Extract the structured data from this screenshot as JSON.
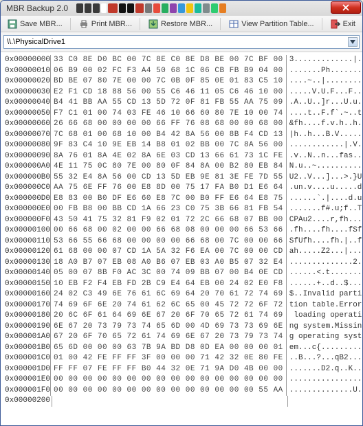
{
  "window": {
    "title": "MBR Backup 2.0"
  },
  "toolbar": {
    "save_label": "Save MBR...",
    "print_label": "Print MBR...",
    "restore_label": "Restore MBR...",
    "view_label": "View Partition Table...",
    "exit_label": "Exit"
  },
  "drive_selector": {
    "value": "\\\\.\\PhysicalDrive1"
  },
  "blur_blocks": [
    {
      "w": 10,
      "c": "#3a3a3a"
    },
    {
      "w": 10,
      "c": "#3a3a3a"
    },
    {
      "w": 10,
      "c": "#3a3a3a"
    },
    {
      "w": 8,
      "c": "#fff"
    },
    {
      "w": 14,
      "c": "#c0392b"
    },
    {
      "w": 10,
      "c": "#111"
    },
    {
      "w": 10,
      "c": "#111"
    },
    {
      "w": 12,
      "c": "#c0392b"
    },
    {
      "w": 10,
      "c": "#777"
    },
    {
      "w": 10,
      "c": "#e74c3c"
    },
    {
      "w": 10,
      "c": "#27ae60"
    },
    {
      "w": 10,
      "c": "#8e44ad"
    },
    {
      "w": 10,
      "c": "#3498db"
    },
    {
      "w": 10,
      "c": "#f1c40f"
    },
    {
      "w": 10,
      "c": "#1abc9c"
    },
    {
      "w": 10,
      "c": "#7f8c8d"
    },
    {
      "w": 10,
      "c": "#2ecc71"
    },
    {
      "w": 10,
      "c": "#e67e22"
    }
  ],
  "rows": [
    {
      "addr": "0x00000000",
      "hex": "33 C0 8E D0 BC 00 7C 8E C0 8E D8 BE 00 7C BF 00",
      "ascii": "3.............|.."
    },
    {
      "addr": "0x00000010",
      "hex": "06 B9 00 02 FC F3 A4 50 68 1C 06 CB FB B9 04 00",
      "ascii": ".......Ph......."
    },
    {
      "addr": "0x00000020",
      "hex": "BD BE 07 80 7E 00 00 7C 0B 0F 85 0E 01 83 C5 10",
      "ascii": "....~..|........"
    },
    {
      "addr": "0x00000030",
      "hex": "E2 F1 CD 18 88 56 00 55 C6 46 11 05 C6 46 10 00",
      "ascii": ".....V.U.F...F.."
    },
    {
      "addr": "0x00000040",
      "hex": "B4 41 BB AA 55 CD 13 5D 72 0F 81 FB 55 AA 75 09",
      "ascii": ".A..U..]r...U.u."
    },
    {
      "addr": "0x00000050",
      "hex": "F7 C1 01 00 74 03 FE 46 10 66 60 80 7E 10 00 74",
      "ascii": "....t..F.f`.~..t"
    },
    {
      "addr": "0x00000060",
      "hex": "26 66 68 00 00 00 00 66 FF 76 08 68 00 00 68 00",
      "ascii": "&fh....f.v.h..h."
    },
    {
      "addr": "0x00000070",
      "hex": "7C 68 01 00 68 10 00 B4 42 8A 56 00 8B F4 CD 13",
      "ascii": "|h..h...B.V....."
    },
    {
      "addr": "0x00000080",
      "hex": "9F 83 C4 10 9E EB 14 B8 01 02 BB 00 7C 8A 56 00",
      "ascii": "............|.V."
    },
    {
      "addr": "0x00000090",
      "hex": "8A 76 01 8A 4E 02 8A 6E 03 CD 13 66 61 73 1C FE",
      "ascii": ".v..N..n...fas.."
    },
    {
      "addr": "0x000000A0",
      "hex": "4E 11 75 0C 80 7E 00 80 0F 84 8A 00 B2 80 EB 84",
      "ascii": "N.u..~.........."
    },
    {
      "addr": "0x000000B0",
      "hex": "55 32 E4 8A 56 00 CD 13 5D EB 9E 81 3E FE 7D 55",
      "ascii": "U2..V...]...>.}U"
    },
    {
      "addr": "0x000000C0",
      "hex": "AA 75 6E FF 76 00 E8 8D 00 75 17 FA B0 D1 E6 64",
      "ascii": ".un.v....u.....d"
    },
    {
      "addr": "0x000000D0",
      "hex": "E8 83 00 B0 DF E6 60 E8 7C 00 B0 FF E6 64 E8 75",
      "ascii": "......`.|....d.u"
    },
    {
      "addr": "0x000000E0",
      "hex": "00 FB B8 00 BB CD 1A 66 23 C0 75 3B 66 81 FB 54",
      "ascii": ".......f#.u;f..T"
    },
    {
      "addr": "0x000000F0",
      "hex": "43 50 41 75 32 81 F9 02 01 72 2C 66 68 07 BB 00",
      "ascii": "CPAu2....r,fh..."
    },
    {
      "addr": "0x00000100",
      "hex": "00 66 68 00 02 00 00 66 68 08 00 00 00 66 53 66",
      "ascii": ".fh....fh....fSf"
    },
    {
      "addr": "0x00000110",
      "hex": "53 66 55 66 68 00 00 00 00 66 68 00 7C 00 00 66",
      "ascii": "SfUfh....fh.|..f"
    },
    {
      "addr": "0x00000120",
      "hex": "61 68 00 00 07 CD 1A 5A 32 F6 EA 00 7C 00 00 CD",
      "ascii": "ah.....Z2...|..."
    },
    {
      "addr": "0x00000130",
      "hex": "18 A0 B7 07 EB 08 A0 B6 07 EB 03 A0 B5 07 32 E4",
      "ascii": "..............2."
    },
    {
      "addr": "0x00000140",
      "hex": "05 00 07 8B F0 AC 3C 00 74 09 BB 07 00 B4 0E CD",
      "ascii": "......<.t......."
    },
    {
      "addr": "0x00000150",
      "hex": "10 EB F2 F4 EB FD 2B C9 E4 64 EB 00 24 02 E0 F8",
      "ascii": "......+..d..$..."
    },
    {
      "addr": "0x00000160",
      "hex": "24 02 C3 49 6E 76 61 6C 69 64 20 70 61 72 74 69",
      "ascii": "$..Invalid parti"
    },
    {
      "addr": "0x00000170",
      "hex": "74 69 6F 6E 20 74 61 62 6C 65 00 45 72 72 6F 72",
      "ascii": "tion table.Error"
    },
    {
      "addr": "0x00000180",
      "hex": "20 6C 6F 61 64 69 6E 67 20 6F 70 65 72 61 74 69",
      "ascii": " loading operati"
    },
    {
      "addr": "0x00000190",
      "hex": "6E 67 20 73 79 73 74 65 6D 00 4D 69 73 73 69 6E",
      "ascii": "ng system.Missin"
    },
    {
      "addr": "0x000001A0",
      "hex": "67 20 6F 70 65 72 61 74 69 6E 67 20 73 79 73 74",
      "ascii": "g operating syst"
    },
    {
      "addr": "0x000001B0",
      "hex": "65 6D 00 00 00 63 7B 9A BD D8 0D EA 00 00 00 01",
      "ascii": "em...c{........."
    },
    {
      "addr": "0x000001C0",
      "hex": "01 00 42 FE FF FF 3F 00 00 00 71 42 32 0E 80 FE",
      "ascii": "..B...?...qB2..."
    },
    {
      "addr": "0x000001D0",
      "hex": "FF FF 07 FE FF FF B0 44 32 0E 71 9A D0 4B 00 00",
      "ascii": ".......D2.q..K.."
    },
    {
      "addr": "0x000001E0",
      "hex": "00 00 00 00 00 00 00 00 00 00 00 00 00 00 00 00",
      "ascii": "................"
    },
    {
      "addr": "0x000001F0",
      "hex": "00 00 00 00 00 00 00 00 00 00 00 00 00 00 55 AA",
      "ascii": "..............U."
    },
    {
      "addr": "0x00000200",
      "hex": "",
      "ascii": ""
    }
  ]
}
